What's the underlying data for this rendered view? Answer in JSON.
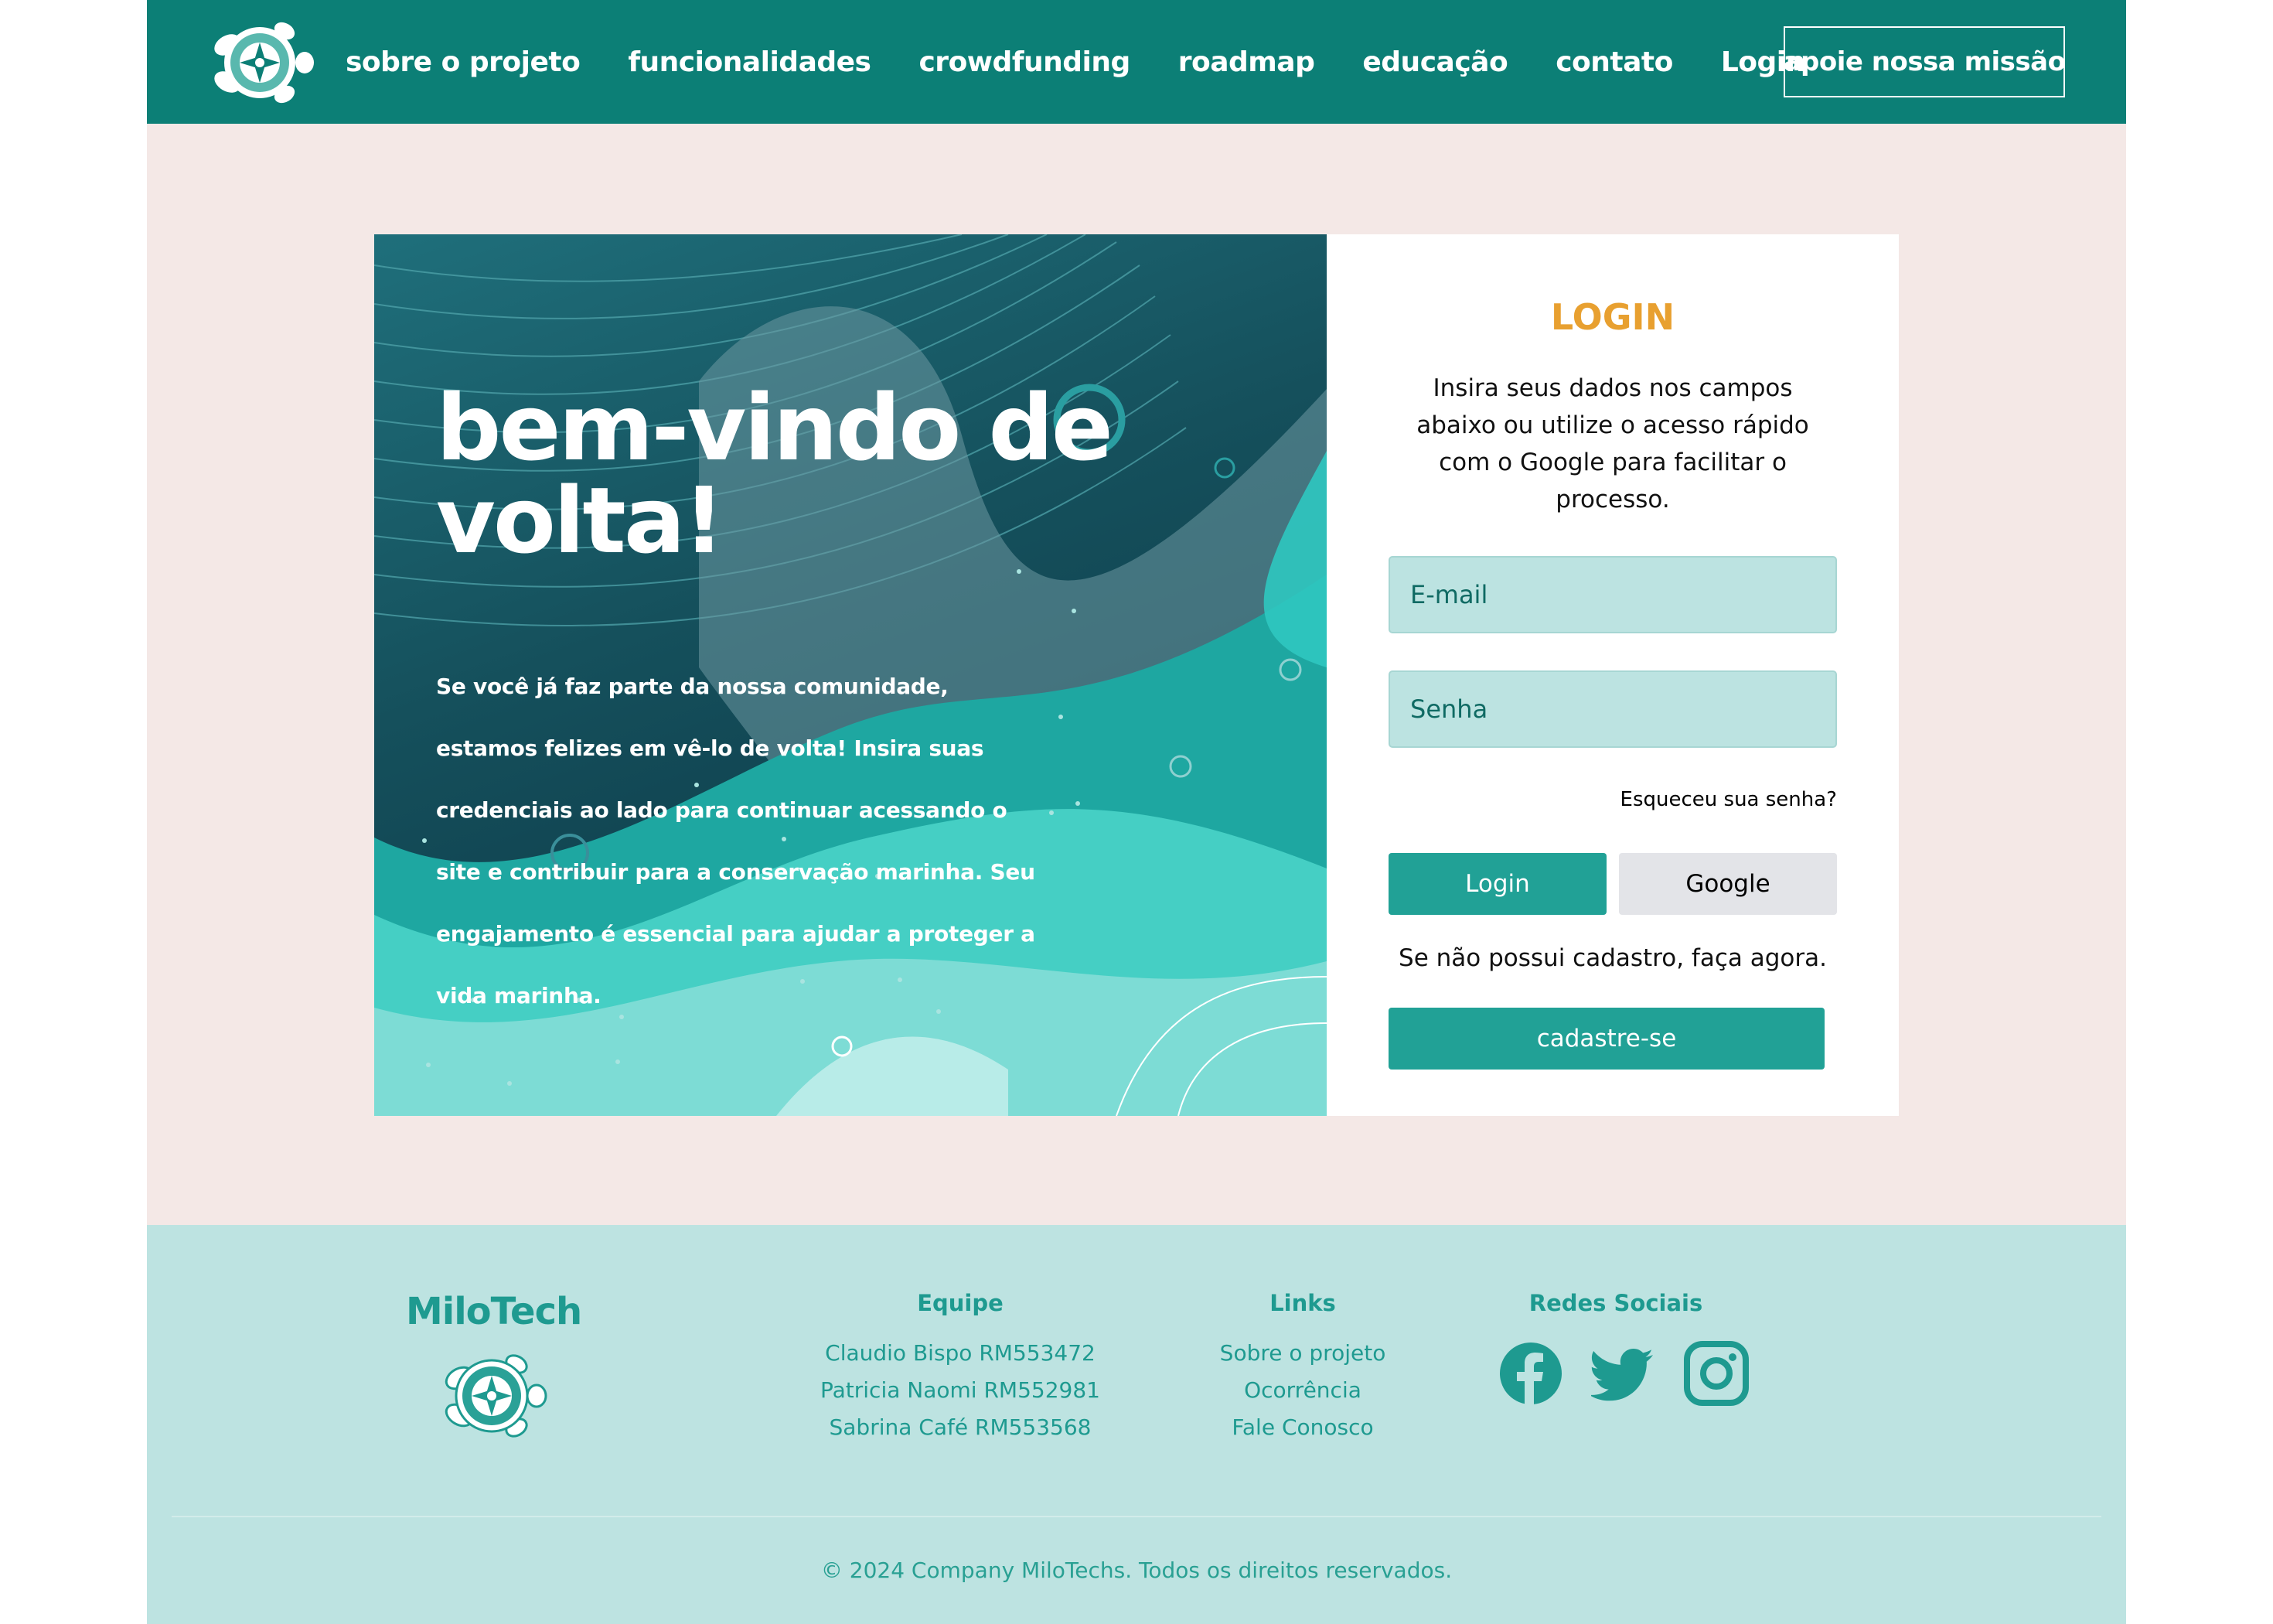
{
  "header": {
    "logo_icon": "turtle-icon",
    "nav": [
      {
        "label": "sobre o projeto"
      },
      {
        "label": "funcionalidades"
      },
      {
        "label": "crowdfunding"
      },
      {
        "label": "roadmap"
      },
      {
        "label": "educação"
      },
      {
        "label": "contato"
      },
      {
        "label": "Login"
      }
    ],
    "cta_label": "apoie nossa missão"
  },
  "hero": {
    "title": "bem-vindo de volta!",
    "text": "Se você já faz parte da nossa comunidade, estamos felizes em vê-lo de volta! Insira suas credenciais ao lado para continuar acessando o site e contribuir para a conservação marinha. Seu engajamento é essencial para ajudar a proteger a vida marinha."
  },
  "login": {
    "title": "LOGIN",
    "description": "Insira seus dados nos campos abaixo ou utilize o acesso rápido com o Google para facilitar o processo.",
    "email_placeholder": "E-mail",
    "password_placeholder": "Senha",
    "forgot_label": "Esqueceu sua senha?",
    "login_button": "Login",
    "google_button": "Google",
    "signup_text": "Se não possui cadastro, faça agora.",
    "signup_button": "cadastre-se"
  },
  "footer": {
    "brand": "MiloTech",
    "team_title": "Equipe",
    "team": [
      "Claudio Bispo RM553472",
      "Patricia Naomi RM552981",
      "Sabrina Café RM553568"
    ],
    "links_title": "Links",
    "links": [
      "Sobre o projeto",
      "Ocorrência",
      "Fale Conosco"
    ],
    "social_title": "Redes Sociais",
    "social_icons": [
      "facebook-icon",
      "twitter-icon",
      "instagram-icon"
    ],
    "copyright": "© 2024 Company MiloTechs. Todos os direitos reservados."
  },
  "colors": {
    "header_bg": "#0c7f76",
    "page_bg": "#f4e8e6",
    "accent": "#21a196",
    "login_title": "#e8a030",
    "footer_bg": "#bde3e1"
  }
}
